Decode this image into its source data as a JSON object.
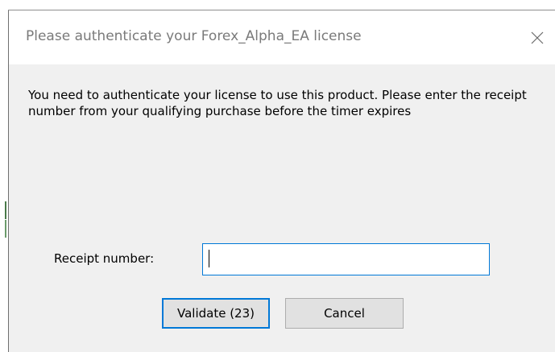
{
  "dialog": {
    "title": "Please authenticate your Forex_Alpha_EA license",
    "close_icon": "close-x-icon",
    "message": "You need to authenticate your license to use this product. Please enter the receipt number from your qualifying purchase before the timer expires",
    "receipt_label": "Receipt number:",
    "receipt_value": "",
    "validate_label": "Validate (23)",
    "cancel_label": "Cancel"
  },
  "colors": {
    "accent": "#0078d7",
    "dialog_bg": "#f0f0f0",
    "title_text": "#7a7a7a"
  }
}
